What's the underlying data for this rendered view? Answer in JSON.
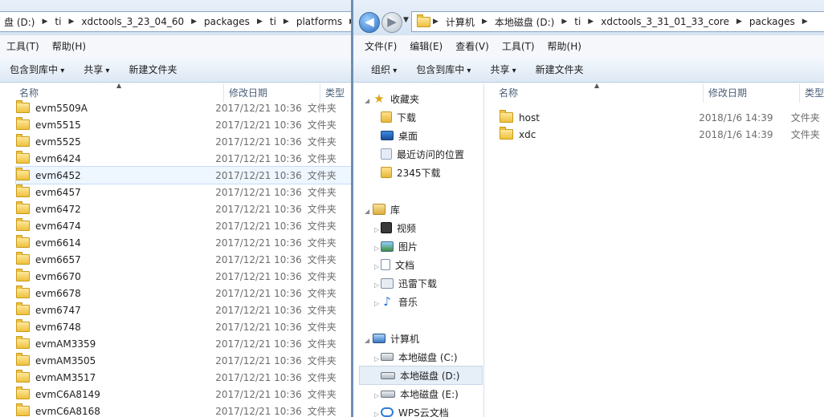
{
  "left": {
    "breadcrumbs": [
      "盘 (D:)",
      "ti",
      "xdctools_3_23_04_60",
      "packages",
      "ti",
      "platforms"
    ],
    "menu": [
      "工具(T)",
      "帮助(H)"
    ],
    "toolbar": [
      "包含到库中",
      "共享",
      "新建文件夹"
    ],
    "columns": {
      "name": "名称",
      "date": "修改日期",
      "type": "类型"
    },
    "rows": [
      {
        "name": "evm5509A",
        "date": "2017/12/21 10:36",
        "type": "文件夹"
      },
      {
        "name": "evm5515",
        "date": "2017/12/21 10:36",
        "type": "文件夹"
      },
      {
        "name": "evm5525",
        "date": "2017/12/21 10:36",
        "type": "文件夹"
      },
      {
        "name": "evm6424",
        "date": "2017/12/21 10:36",
        "type": "文件夹"
      },
      {
        "name": "evm6452",
        "date": "2017/12/21 10:36",
        "type": "文件夹"
      },
      {
        "name": "evm6457",
        "date": "2017/12/21 10:36",
        "type": "文件夹"
      },
      {
        "name": "evm6472",
        "date": "2017/12/21 10:36",
        "type": "文件夹"
      },
      {
        "name": "evm6474",
        "date": "2017/12/21 10:36",
        "type": "文件夹"
      },
      {
        "name": "evm6614",
        "date": "2017/12/21 10:36",
        "type": "文件夹"
      },
      {
        "name": "evm6657",
        "date": "2017/12/21 10:36",
        "type": "文件夹"
      },
      {
        "name": "evm6670",
        "date": "2017/12/21 10:36",
        "type": "文件夹"
      },
      {
        "name": "evm6678",
        "date": "2017/12/21 10:36",
        "type": "文件夹"
      },
      {
        "name": "evm6747",
        "date": "2017/12/21 10:36",
        "type": "文件夹"
      },
      {
        "name": "evm6748",
        "date": "2017/12/21 10:36",
        "type": "文件夹"
      },
      {
        "name": "evmAM3359",
        "date": "2017/12/21 10:36",
        "type": "文件夹"
      },
      {
        "name": "evmAM3505",
        "date": "2017/12/21 10:36",
        "type": "文件夹"
      },
      {
        "name": "evmAM3517",
        "date": "2017/12/21 10:36",
        "type": "文件夹"
      },
      {
        "name": "evmC6A8149",
        "date": "2017/12/21 10:36",
        "type": "文件夹"
      },
      {
        "name": "evmC6A8168",
        "date": "2017/12/21 10:36",
        "type": "文件夹"
      }
    ],
    "selected_index": 4
  },
  "right": {
    "breadcrumbs": [
      "计算机",
      "本地磁盘 (D:)",
      "ti",
      "xdctools_3_31_01_33_core",
      "packages"
    ],
    "menu": [
      "文件(F)",
      "编辑(E)",
      "查看(V)",
      "工具(T)",
      "帮助(H)"
    ],
    "toolbar": [
      "组织",
      "包含到库中",
      "共享",
      "新建文件夹"
    ],
    "columns": {
      "name": "名称",
      "date": "修改日期",
      "type": "类型"
    },
    "rows": [
      {
        "name": "host",
        "date": "2018/1/6 14:39",
        "type": "文件夹"
      },
      {
        "name": "xdc",
        "date": "2018/1/6 14:39",
        "type": "文件夹"
      }
    ],
    "nav": {
      "favorites": {
        "label": "收藏夹",
        "items": [
          "下载",
          "桌面",
          "最近访问的位置",
          "2345下载"
        ]
      },
      "libraries": {
        "label": "库",
        "items": [
          "视频",
          "图片",
          "文档",
          "迅雷下载",
          "音乐"
        ]
      },
      "computer": {
        "label": "计算机",
        "items": [
          "本地磁盘 (C:)",
          "本地磁盘 (D:)",
          "本地磁盘 (E:)",
          "WPS云文档"
        ]
      }
    }
  }
}
